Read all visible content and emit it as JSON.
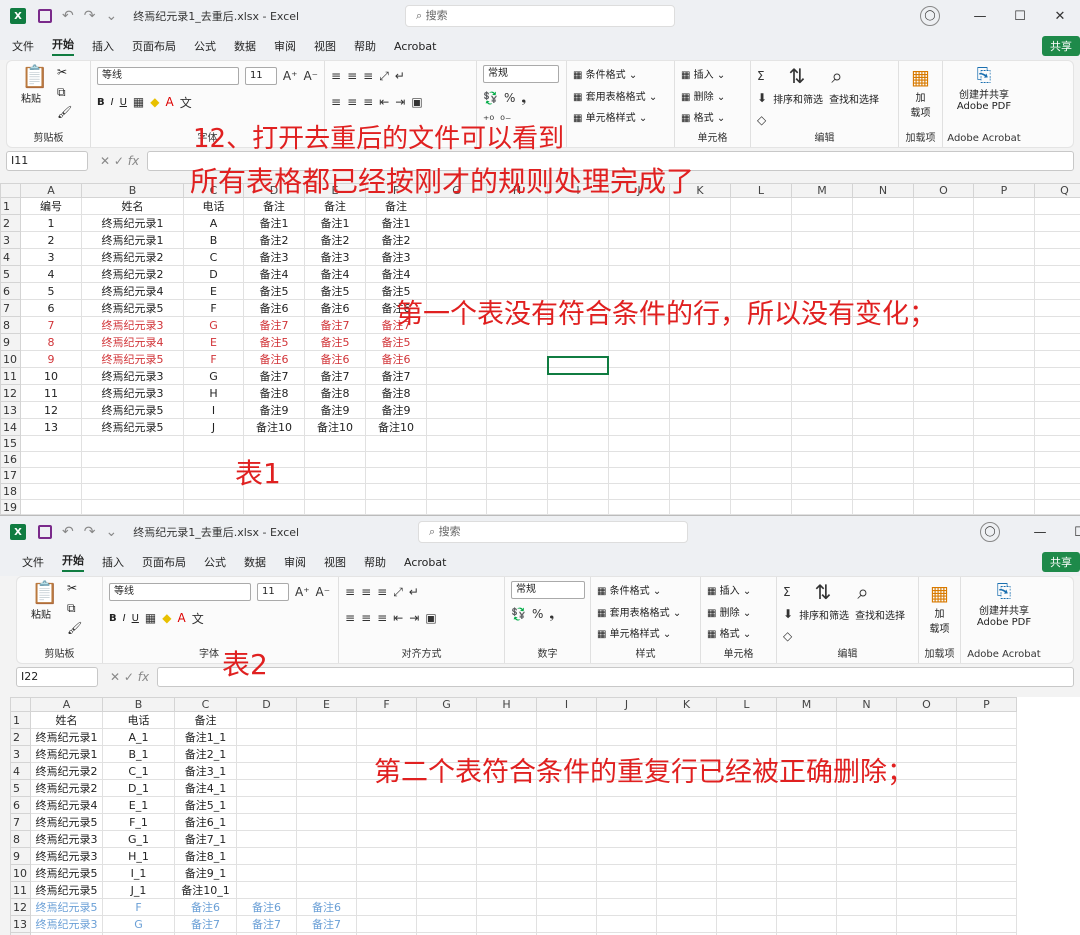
{
  "window1": {
    "title": "终焉纪元录1_去重后.xlsx  -  Excel",
    "search_placeholder": "搜索",
    "share": "共享",
    "tabs": [
      "文件",
      "开始",
      "插入",
      "页面布局",
      "公式",
      "数据",
      "审阅",
      "视图",
      "帮助",
      "Acrobat"
    ],
    "ribbon": {
      "paste": "粘贴",
      "clipboard": "剪贴板",
      "font_name": "等线",
      "font_size": "11",
      "font_group": "字体",
      "number_format": "常规",
      "conditional": "条件格式",
      "table_format": "套用表格格式",
      "cell_style": "单元格样式",
      "insert": "插入",
      "delete": "删除",
      "format": "格式",
      "cells": "单元格",
      "sort_filter": "排序和筛选",
      "find_select": "查找和选择",
      "edit": "编辑",
      "addin": "加载项",
      "addin_btn": "加\n载项",
      "create_pdf": "创建并共享\nAdobe PDF",
      "adobe": "Adobe Acrobat"
    },
    "name_box": "I11",
    "columns": [
      "A",
      "B",
      "C",
      "D",
      "E",
      "F",
      "G",
      "H",
      "I",
      "J",
      "K",
      "L",
      "M",
      "N",
      "O",
      "P",
      "Q"
    ],
    "rows": [
      [
        "编号",
        "姓名",
        "电话",
        "备注",
        "备注",
        "备注"
      ],
      [
        "1",
        "终焉纪元录1",
        "A",
        "备注1",
        "备注1",
        "备注1"
      ],
      [
        "2",
        "终焉纪元录1",
        "B",
        "备注2",
        "备注2",
        "备注2"
      ],
      [
        "3",
        "终焉纪元录2",
        "C",
        "备注3",
        "备注3",
        "备注3"
      ],
      [
        "4",
        "终焉纪元录2",
        "D",
        "备注4",
        "备注4",
        "备注4"
      ],
      [
        "5",
        "终焉纪元录4",
        "E",
        "备注5",
        "备注5",
        "备注5"
      ],
      [
        "6",
        "终焉纪元录5",
        "F",
        "备注6",
        "备注6",
        "备注6"
      ],
      [
        "7",
        "终焉纪元录3",
        "G",
        "备注7",
        "备注7",
        "备注7"
      ],
      [
        "8",
        "终焉纪元录4",
        "E",
        "备注5",
        "备注5",
        "备注5"
      ],
      [
        "9",
        "终焉纪元录5",
        "F",
        "备注6",
        "备注6",
        "备注6"
      ],
      [
        "10",
        "终焉纪元录3",
        "G",
        "备注7",
        "备注7",
        "备注7"
      ],
      [
        "11",
        "终焉纪元录3",
        "H",
        "备注8",
        "备注8",
        "备注8"
      ],
      [
        "12",
        "终焉纪元录5",
        "I",
        "备注9",
        "备注9",
        "备注9"
      ],
      [
        "13",
        "终焉纪元录5",
        "J",
        "备注10",
        "备注10",
        "备注10"
      ],
      [
        "",
        "",
        "",
        "",
        "",
        ""
      ],
      [
        "",
        "",
        "",
        "",
        "",
        ""
      ],
      [
        "",
        "",
        "",
        "",
        "",
        ""
      ],
      [
        "",
        "",
        "",
        "",
        "",
        ""
      ],
      [
        "",
        "",
        "",
        "",
        "",
        ""
      ],
      [
        "",
        "",
        "",
        "",
        "",
        ""
      ]
    ],
    "red_rows": [
      8,
      9,
      10
    ]
  },
  "window2": {
    "title": "终焉纪元录1_去重后.xlsx  -  Excel",
    "search_placeholder": "搜索",
    "share": "共享",
    "ribbon": {
      "align": "对齐方式",
      "number": "数字",
      "style": "样式"
    },
    "name_box": "I22",
    "columns": [
      "A",
      "B",
      "C",
      "D",
      "E",
      "F",
      "G",
      "H",
      "I",
      "J",
      "K",
      "L",
      "M",
      "N",
      "O",
      "P"
    ],
    "rows": [
      [
        "姓名",
        "电话",
        "备注",
        "",
        ""
      ],
      [
        "终焉纪元录1",
        "A_1",
        "备注1_1",
        "",
        ""
      ],
      [
        "终焉纪元录1",
        "B_1",
        "备注2_1",
        "",
        ""
      ],
      [
        "终焉纪元录2",
        "C_1",
        "备注3_1",
        "",
        ""
      ],
      [
        "终焉纪元录2",
        "D_1",
        "备注4_1",
        "",
        ""
      ],
      [
        "终焉纪元录4",
        "E_1",
        "备注5_1",
        "",
        ""
      ],
      [
        "终焉纪元录5",
        "F_1",
        "备注6_1",
        "",
        ""
      ],
      [
        "终焉纪元录3",
        "G_1",
        "备注7_1",
        "",
        ""
      ],
      [
        "终焉纪元录3",
        "H_1",
        "备注8_1",
        "",
        ""
      ],
      [
        "终焉纪元录5",
        "I_1",
        "备注9_1",
        "",
        ""
      ],
      [
        "终焉纪元录5",
        "J_1",
        "备注10_1",
        "",
        ""
      ],
      [
        "终焉纪元录5",
        "F",
        "备注6",
        "备注6",
        "备注6"
      ],
      [
        "终焉纪元录3",
        "G",
        "备注7",
        "备注7",
        "备注7"
      ],
      [
        "",
        "",
        "",
        "",
        ""
      ]
    ],
    "blue_rows": [
      12,
      13
    ]
  },
  "annotations": {
    "step": "12、打开去重后的文件可以看到",
    "all_done": "所有表格都已经按刚才的规则处理完成了",
    "sheet1_note": "第一个表没有符合条件的行，所以没有变化；",
    "sheet1_label": "表1",
    "sheet2_label": "表2",
    "sheet2_note": "第二个表符合条件的重复行已经被正确删除；"
  },
  "colors": {
    "excel_green": "#107c41",
    "annotation_red": "#e02020",
    "dup_red": "#d13438",
    "dup_blue": "#6a9fd6"
  }
}
